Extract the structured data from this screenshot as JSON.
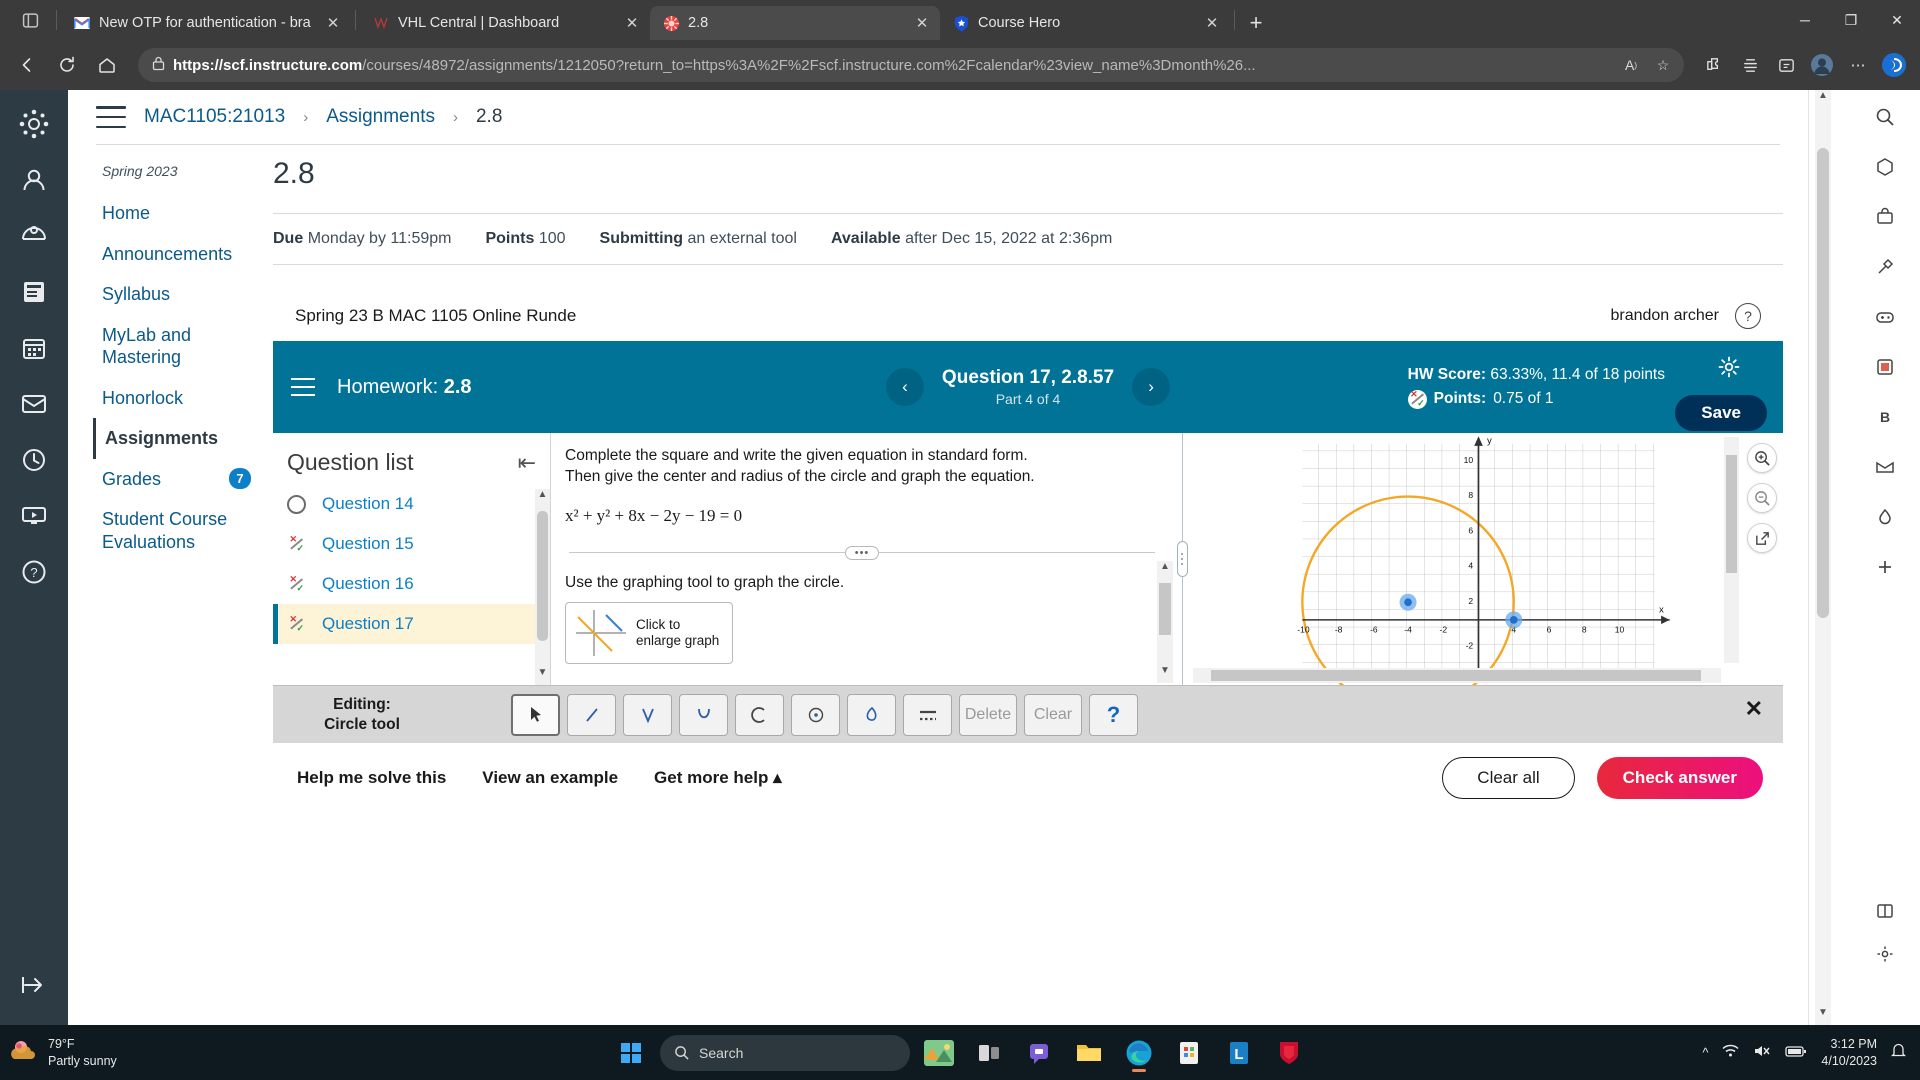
{
  "browser": {
    "tabs": [
      {
        "favicon": "gmail-icon",
        "title": "New OTP for authentication - bra",
        "active": false
      },
      {
        "favicon": "vhl-icon",
        "title": "VHL Central | Dashboard",
        "active": false
      },
      {
        "favicon": "mylab-icon",
        "title": "2.8",
        "active": true
      },
      {
        "favicon": "coursehero-icon",
        "title": "Course Hero",
        "active": false
      }
    ],
    "url_bold": "https://scf.instructure.com",
    "url_rest": "/courses/48972/assignments/1212050?return_to=https%3A%2F%2Fscf.instructure.com%2Fcalendar%23view_name%3Dmonth%26...",
    "new_tab_label": "+",
    "close_label": "✕",
    "minimize_label": "─",
    "maximize_label": "❐"
  },
  "canvas": {
    "breadcrumb": {
      "course": "MAC1105:21013",
      "section": "Assignments",
      "current": "2.8",
      "separator": "›"
    },
    "term": "Spring 2023",
    "nav_items": [
      {
        "label": "Home",
        "active": false,
        "badge": null
      },
      {
        "label": "Announcements",
        "active": false,
        "badge": null
      },
      {
        "label": "Syllabus",
        "active": false,
        "badge": null
      },
      {
        "label": "MyLab and Mastering",
        "active": false,
        "badge": null
      },
      {
        "label": "Honorlock",
        "active": false,
        "badge": null
      },
      {
        "label": "Assignments",
        "active": true,
        "badge": null
      },
      {
        "label": "Grades",
        "active": false,
        "badge": "7"
      },
      {
        "label": "Student Course Evaluations",
        "active": false,
        "badge": null
      }
    ],
    "assignment_title": "2.8",
    "meta": [
      {
        "label": "Due",
        "value": "Monday by 11:59pm"
      },
      {
        "label": "Points",
        "value": "100"
      },
      {
        "label": "Submitting",
        "value": "an external tool"
      },
      {
        "label": "Available",
        "value": "after Dec 15, 2022 at 2:36pm"
      }
    ]
  },
  "mylab": {
    "course_name": "Spring 23 B MAC 1105 Online Runde",
    "user_name": "brandon archer",
    "help_icon_label": "?",
    "homework_prefix": "Homework:",
    "homework_number": "2.8",
    "prev_label": "‹",
    "next_label": "›",
    "question_heading": "Question 17, 2.8.57",
    "question_part": "Part 4 of 4",
    "hw_score_label": "HW Score:",
    "hw_score_value": "63.33%, 11.4 of 18 points",
    "points_label": "Points:",
    "points_value": "0.75 of 1",
    "save_label": "Save",
    "gear_icon": "gear-icon",
    "question_list": {
      "title": "Question list",
      "collapse_label": "⇤",
      "items": [
        {
          "label": "Question 14",
          "status": "unanswered",
          "selected": false
        },
        {
          "label": "Question 15",
          "status": "partial",
          "selected": false
        },
        {
          "label": "Question 16",
          "status": "partial",
          "selected": false
        },
        {
          "label": "Question 17",
          "status": "partial",
          "selected": true
        }
      ]
    },
    "prompt_line1": "Complete the square and write the given equation in standard form.",
    "prompt_line2": "Then give the center and radius of the circle and graph the equation.",
    "equation": "x² + y² + 8x − 2y − 19 = 0",
    "sub_prompt": "Use the graphing tool to graph the circle.",
    "enlarge_label": "Click to enlarge graph",
    "divider_dots": "•••",
    "editing_label_line1": "Editing:",
    "editing_label_line2": "Circle tool",
    "toolbar_buttons": [
      {
        "name": "pointer-tool",
        "glyph": "➤",
        "selected": true
      },
      {
        "name": "line-tool",
        "glyph": "/",
        "selected": false
      },
      {
        "name": "vshape-tool",
        "glyph": "V",
        "selected": false
      },
      {
        "name": "parabola-tool",
        "glyph": "U",
        "selected": false
      },
      {
        "name": "arc-tool",
        "glyph": "C",
        "selected": false
      },
      {
        "name": "circle-tool",
        "glyph": "⊙",
        "selected": false
      },
      {
        "name": "fill-tool",
        "glyph": "◖",
        "selected": false
      },
      {
        "name": "line-style-tool",
        "glyph": "—",
        "selected": false
      }
    ],
    "delete_label": "Delete",
    "clear_label": "Clear",
    "help_label": "?",
    "close_label": "✕",
    "footer_links": [
      "Help me solve this",
      "View an example",
      "Get more help ▴"
    ],
    "clear_all_label": "Clear all",
    "check_answer_label": "Check answer"
  },
  "chart_data": {
    "type": "scatter",
    "title": "",
    "xlabel": "x",
    "ylabel": "y",
    "xlim": [
      -10,
      10
    ],
    "ylim": [
      -4,
      10
    ],
    "xticks": [
      "-10",
      "-8",
      "-6",
      "-4",
      "-2",
      "2",
      "4",
      "6",
      "8",
      "10"
    ],
    "yticks": [
      "-2",
      "2",
      "4",
      "6",
      "8",
      "10"
    ],
    "grid": true,
    "series": [
      {
        "name": "circle",
        "type": "circle",
        "center": [
          -4,
          1
        ],
        "radius": 6,
        "color": "#f5a623"
      },
      {
        "name": "center-point",
        "type": "point",
        "x": -4,
        "y": 1,
        "color": "#1f7ae0"
      },
      {
        "name": "radius-point",
        "type": "point",
        "x": 2,
        "y": 0,
        "color": "#1f7ae0"
      }
    ]
  },
  "taskbar": {
    "weather_temp": "79°F",
    "weather_desc": "Partly sunny",
    "search_placeholder": "Search",
    "time": "3:12 PM",
    "date": "4/10/2023",
    "apps": [
      {
        "name": "start-button"
      },
      {
        "name": "widgets-icon"
      },
      {
        "name": "task-view-icon"
      },
      {
        "name": "chat-icon"
      },
      {
        "name": "file-explorer-icon"
      },
      {
        "name": "edge-icon"
      },
      {
        "name": "store-icon"
      },
      {
        "name": "lastpass-icon"
      },
      {
        "name": "mcafee-icon"
      }
    ],
    "tray": [
      "chevron-up-icon",
      "wifi-icon",
      "volume-mute-icon",
      "battery-icon",
      "notification-icon"
    ]
  },
  "colors": {
    "teal": "#007396",
    "canvas_blue": "#0b5a8a",
    "orange": "#f5a623",
    "pink": "#ec0f7e",
    "navy": "#2d3b45"
  }
}
